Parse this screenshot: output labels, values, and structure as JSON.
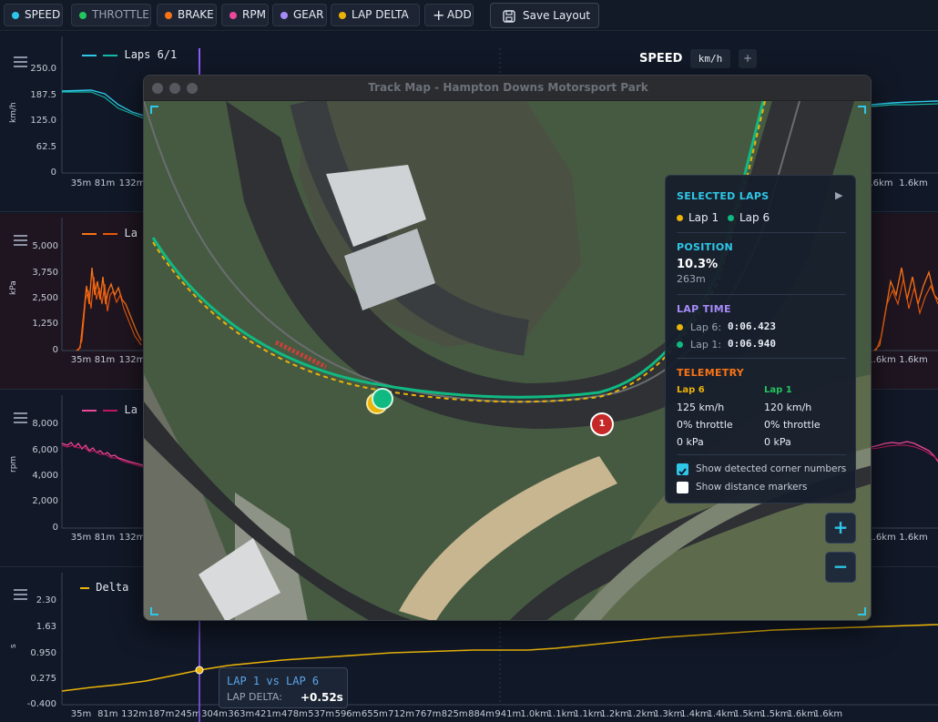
{
  "toolbar": {
    "chips": [
      {
        "label": "SPEED",
        "color": "#2ec7e8"
      },
      {
        "label": "THROTTLE",
        "color": "#22c55e"
      },
      {
        "label": "BRAKE",
        "color": "#f97316"
      },
      {
        "label": "RPM",
        "color": "#ec4899"
      },
      {
        "label": "GEAR",
        "color": "#a78bfa"
      },
      {
        "label": "LAP DELTA",
        "color": "#eab308"
      }
    ],
    "add_label": "ADD",
    "save_label": "Save Layout"
  },
  "speed_header": {
    "title": "SPEED",
    "unit_btn": "km/h",
    "add": "+"
  },
  "panels": {
    "speed": {
      "legend": "Laps 6/1",
      "unit": "km/h",
      "yticks": [
        "250.0",
        "187.5",
        "125.0",
        "62.5",
        "0"
      ],
      "xticks_left": [
        "35m",
        "81m",
        "132m"
      ],
      "xticks_right": [
        ".6km",
        "1.6km"
      ]
    },
    "brake": {
      "legend": "La",
      "unit": "kPa",
      "yticks": [
        "5,000",
        "3,750",
        "2,500",
        "1,250",
        "0"
      ],
      "xticks_left": [
        "35m",
        "81m",
        "132m"
      ],
      "xticks_right": [
        "1.6km",
        "1.6km"
      ]
    },
    "rpm": {
      "legend": "La",
      "unit": "rpm",
      "yticks": [
        "8,000",
        "6,000",
        "4,000",
        "2,000",
        "0"
      ],
      "xticks_left": [
        "35m",
        "81m",
        "132m"
      ],
      "xticks_right": [
        "1.6km",
        "1.6km"
      ]
    },
    "delta": {
      "legend": "Delta",
      "unit": "s",
      "yticks": [
        "2.30",
        "1.63",
        "0.950",
        "0.275",
        "-0.400"
      ],
      "xticks": [
        "35m",
        "81m",
        "132m",
        "187m",
        "245m",
        "304m",
        "363m",
        "421m",
        "478m",
        "537m",
        "596m",
        "655m",
        "712m",
        "767m",
        "825m",
        "884m",
        "941m",
        "1.0km",
        "1.1km",
        "1.1km",
        "1.2km",
        "1.2km",
        "1.3km",
        "1.4km",
        "1.4km",
        "1.5km",
        "1.5km",
        "1.6km",
        "1.6km"
      ]
    }
  },
  "colors": {
    "speed": "#2ec7e8",
    "speed2": "#14b8a6",
    "brake": "#f97316",
    "brake2": "#ea580c",
    "rpm": "#ec4899",
    "rpm2": "#be185d",
    "delta": "#eab308",
    "cursor": "#8b5cf6"
  },
  "window": {
    "title": "Track Map - Hampton Downs Motorsport Park"
  },
  "info": {
    "selected_laps": "SELECTED LAPS",
    "play_icon": "▶",
    "laps": [
      {
        "label": "Lap 1",
        "color": "#eab308"
      },
      {
        "label": "Lap 6",
        "color": "#10b981"
      }
    ],
    "position_title": "POSITION",
    "position_pct": "10.3%",
    "position_m": "263m",
    "laptime_title": "LAP TIME",
    "laptimes": [
      {
        "label": "Lap 6:",
        "value": "0:06.423",
        "color": "#eab308"
      },
      {
        "label": "Lap 1:",
        "value": "0:06.940",
        "color": "#10b981"
      }
    ],
    "telemetry_title": "TELEMETRY",
    "tele_cols": [
      {
        "head": "Lap 6",
        "color": "#eab308",
        "rows": [
          "125 km/h",
          "0% throttle",
          "0 kPa"
        ]
      },
      {
        "head": "Lap 1",
        "color": "#22c55e",
        "rows": [
          "120 km/h",
          "0% throttle",
          "0 kPa"
        ]
      }
    ],
    "checkboxes": [
      {
        "label": "Show detected corner numbers",
        "checked": true
      },
      {
        "label": "Show distance markers",
        "checked": false
      }
    ]
  },
  "corner_badge": "1",
  "zoom": {
    "in": "+",
    "out": "−"
  },
  "tooltip": {
    "title": "LAP 1 vs LAP 6",
    "label": "LAP DELTA:",
    "value": "+0.52s"
  }
}
